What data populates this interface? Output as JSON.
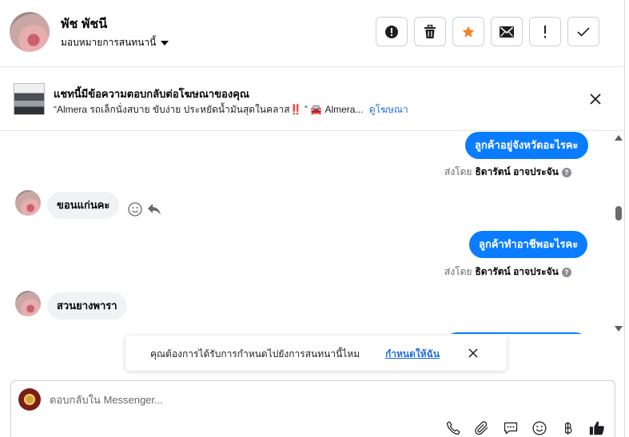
{
  "header": {
    "contact_name": "พัช พัชนี",
    "assign_label": "มอบหมายการสนทนานี้",
    "actions": [
      {
        "name": "mark-spam-button",
        "icon": "alert-circle-icon"
      },
      {
        "name": "delete-button",
        "icon": "trash-icon"
      },
      {
        "name": "star-button",
        "icon": "star-icon",
        "color": "#f5831f"
      },
      {
        "name": "mark-unread-button",
        "icon": "envelope-icon"
      },
      {
        "name": "follow-up-button",
        "icon": "exclamation-icon"
      },
      {
        "name": "mark-done-button",
        "icon": "check-icon"
      }
    ]
  },
  "ad_banner": {
    "title": "แชทนี้มีข้อความตอบกลับต่อโฆษณาของคุณ",
    "subtitle": "“Almera รถเล็กนั่งสบาย ขับง่าย ประหยัดน้ำมันสุดในคลาส‼️ ” 🚘 Almera...",
    "link": "ดูโฆษณา"
  },
  "messages": [
    {
      "direction": "out",
      "text": "ลูกค้าอยู่จังหวัดอะไรคะ",
      "sent_by_prefix": "ส่งโดย",
      "sent_by_name": "ธิดารัตน์ อาจประจัน"
    },
    {
      "direction": "in",
      "text": "ขอนแก่นคะ"
    },
    {
      "direction": "out",
      "text": "ลูกค้าทำอาชีพอะไรคะ",
      "sent_by_prefix": "ส่งโดย",
      "sent_by_name": "ธิดารัตน์ อาจประจัน"
    },
    {
      "direction": "in",
      "text": "สวนยางพารา"
    }
  ],
  "help_glyph": "?",
  "prompt": {
    "text": "คุณต้องการได้รับการกำหนดไปยังการสนทนานี้ไหม",
    "link": "กำหนดให้ฉัน"
  },
  "composer": {
    "placeholder": "ตอบกลับใน Messenger...",
    "tools": [
      "phone-icon",
      "paperclip-icon",
      "saved-reply-icon",
      "emoji-icon",
      "baht-icon",
      "thumbs-up-icon"
    ]
  },
  "colors": {
    "accent": "#0a7cff",
    "link": "#216fdb",
    "star": "#f5831f"
  }
}
